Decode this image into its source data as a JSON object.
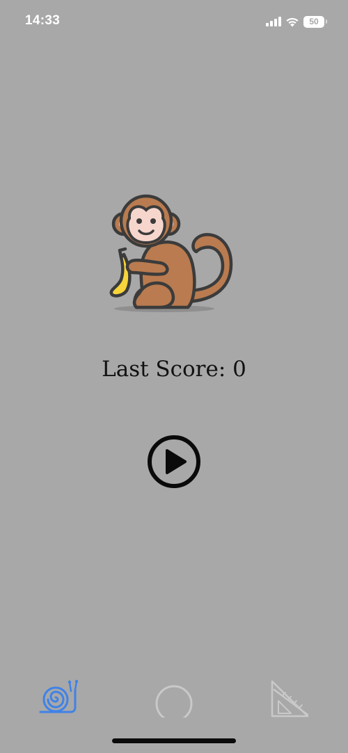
{
  "status_bar": {
    "time": "14:33",
    "battery": "50",
    "signal_icon": "cellular-signal-icon",
    "wifi_icon": "wifi-icon",
    "battery_icon": "battery-icon"
  },
  "main": {
    "mascot_icon": "monkey-with-banana-icon",
    "last_score_label": "Last Score: 0",
    "play_icon": "play-circle-icon"
  },
  "tab_bar": {
    "items": [
      {
        "icon": "snail-icon",
        "active": true,
        "color": "#3f82e8"
      },
      {
        "icon": "circle-icon",
        "active": false,
        "color": "#c9c9c9"
      },
      {
        "icon": "set-square-icon",
        "active": false,
        "color": "#c9c9c9"
      }
    ]
  },
  "colors": {
    "background": "#a8a8a8",
    "accent": "#3f82e8",
    "text": "#111111",
    "inactive_icon": "#c9c9c9"
  }
}
